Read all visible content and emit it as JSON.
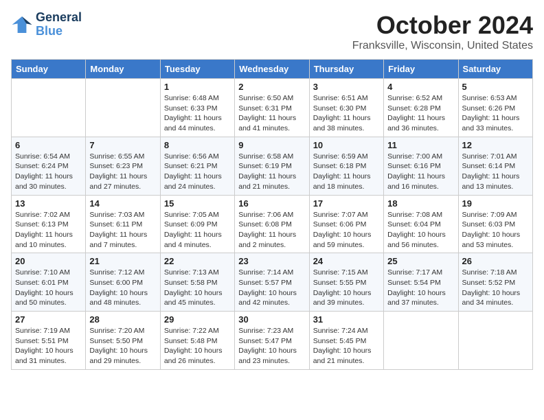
{
  "header": {
    "logo_line1": "General",
    "logo_line2": "Blue",
    "month": "October 2024",
    "location": "Franksville, Wisconsin, United States"
  },
  "weekdays": [
    "Sunday",
    "Monday",
    "Tuesday",
    "Wednesday",
    "Thursday",
    "Friday",
    "Saturday"
  ],
  "weeks": [
    [
      {
        "day": "",
        "detail": ""
      },
      {
        "day": "",
        "detail": ""
      },
      {
        "day": "1",
        "detail": "Sunrise: 6:48 AM\nSunset: 6:33 PM\nDaylight: 11 hours and 44 minutes."
      },
      {
        "day": "2",
        "detail": "Sunrise: 6:50 AM\nSunset: 6:31 PM\nDaylight: 11 hours and 41 minutes."
      },
      {
        "day": "3",
        "detail": "Sunrise: 6:51 AM\nSunset: 6:30 PM\nDaylight: 11 hours and 38 minutes."
      },
      {
        "day": "4",
        "detail": "Sunrise: 6:52 AM\nSunset: 6:28 PM\nDaylight: 11 hours and 36 minutes."
      },
      {
        "day": "5",
        "detail": "Sunrise: 6:53 AM\nSunset: 6:26 PM\nDaylight: 11 hours and 33 minutes."
      }
    ],
    [
      {
        "day": "6",
        "detail": "Sunrise: 6:54 AM\nSunset: 6:24 PM\nDaylight: 11 hours and 30 minutes."
      },
      {
        "day": "7",
        "detail": "Sunrise: 6:55 AM\nSunset: 6:23 PM\nDaylight: 11 hours and 27 minutes."
      },
      {
        "day": "8",
        "detail": "Sunrise: 6:56 AM\nSunset: 6:21 PM\nDaylight: 11 hours and 24 minutes."
      },
      {
        "day": "9",
        "detail": "Sunrise: 6:58 AM\nSunset: 6:19 PM\nDaylight: 11 hours and 21 minutes."
      },
      {
        "day": "10",
        "detail": "Sunrise: 6:59 AM\nSunset: 6:18 PM\nDaylight: 11 hours and 18 minutes."
      },
      {
        "day": "11",
        "detail": "Sunrise: 7:00 AM\nSunset: 6:16 PM\nDaylight: 11 hours and 16 minutes."
      },
      {
        "day": "12",
        "detail": "Sunrise: 7:01 AM\nSunset: 6:14 PM\nDaylight: 11 hours and 13 minutes."
      }
    ],
    [
      {
        "day": "13",
        "detail": "Sunrise: 7:02 AM\nSunset: 6:13 PM\nDaylight: 11 hours and 10 minutes."
      },
      {
        "day": "14",
        "detail": "Sunrise: 7:03 AM\nSunset: 6:11 PM\nDaylight: 11 hours and 7 minutes."
      },
      {
        "day": "15",
        "detail": "Sunrise: 7:05 AM\nSunset: 6:09 PM\nDaylight: 11 hours and 4 minutes."
      },
      {
        "day": "16",
        "detail": "Sunrise: 7:06 AM\nSunset: 6:08 PM\nDaylight: 11 hours and 2 minutes."
      },
      {
        "day": "17",
        "detail": "Sunrise: 7:07 AM\nSunset: 6:06 PM\nDaylight: 10 hours and 59 minutes."
      },
      {
        "day": "18",
        "detail": "Sunrise: 7:08 AM\nSunset: 6:04 PM\nDaylight: 10 hours and 56 minutes."
      },
      {
        "day": "19",
        "detail": "Sunrise: 7:09 AM\nSunset: 6:03 PM\nDaylight: 10 hours and 53 minutes."
      }
    ],
    [
      {
        "day": "20",
        "detail": "Sunrise: 7:10 AM\nSunset: 6:01 PM\nDaylight: 10 hours and 50 minutes."
      },
      {
        "day": "21",
        "detail": "Sunrise: 7:12 AM\nSunset: 6:00 PM\nDaylight: 10 hours and 48 minutes."
      },
      {
        "day": "22",
        "detail": "Sunrise: 7:13 AM\nSunset: 5:58 PM\nDaylight: 10 hours and 45 minutes."
      },
      {
        "day": "23",
        "detail": "Sunrise: 7:14 AM\nSunset: 5:57 PM\nDaylight: 10 hours and 42 minutes."
      },
      {
        "day": "24",
        "detail": "Sunrise: 7:15 AM\nSunset: 5:55 PM\nDaylight: 10 hours and 39 minutes."
      },
      {
        "day": "25",
        "detail": "Sunrise: 7:17 AM\nSunset: 5:54 PM\nDaylight: 10 hours and 37 minutes."
      },
      {
        "day": "26",
        "detail": "Sunrise: 7:18 AM\nSunset: 5:52 PM\nDaylight: 10 hours and 34 minutes."
      }
    ],
    [
      {
        "day": "27",
        "detail": "Sunrise: 7:19 AM\nSunset: 5:51 PM\nDaylight: 10 hours and 31 minutes."
      },
      {
        "day": "28",
        "detail": "Sunrise: 7:20 AM\nSunset: 5:50 PM\nDaylight: 10 hours and 29 minutes."
      },
      {
        "day": "29",
        "detail": "Sunrise: 7:22 AM\nSunset: 5:48 PM\nDaylight: 10 hours and 26 minutes."
      },
      {
        "day": "30",
        "detail": "Sunrise: 7:23 AM\nSunset: 5:47 PM\nDaylight: 10 hours and 23 minutes."
      },
      {
        "day": "31",
        "detail": "Sunrise: 7:24 AM\nSunset: 5:45 PM\nDaylight: 10 hours and 21 minutes."
      },
      {
        "day": "",
        "detail": ""
      },
      {
        "day": "",
        "detail": ""
      }
    ]
  ]
}
